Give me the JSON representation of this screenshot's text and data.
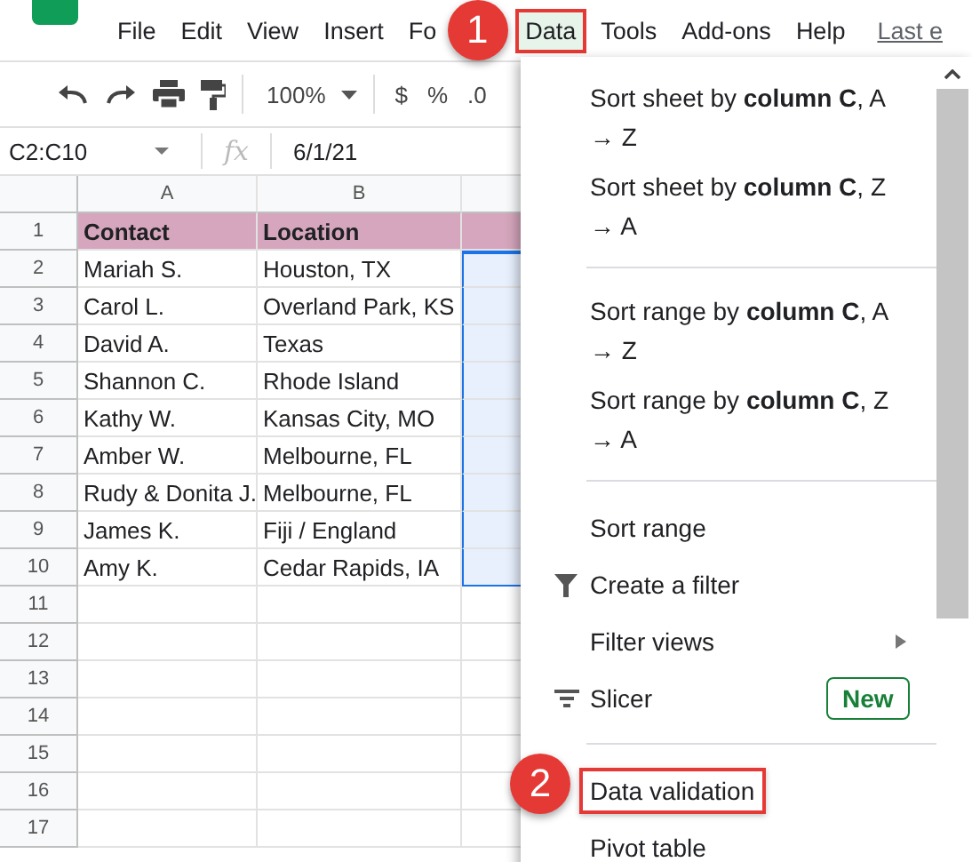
{
  "menu_bar": {
    "items": [
      {
        "label": "File",
        "selected": false
      },
      {
        "label": "Edit",
        "selected": false
      },
      {
        "label": "View",
        "selected": false
      },
      {
        "label": "Insert",
        "selected": false
      },
      {
        "label": "Fo",
        "selected": false
      },
      {
        "label": "Data",
        "selected": true
      },
      {
        "label": "Tools",
        "selected": false
      },
      {
        "label": "Add-ons",
        "selected": false
      },
      {
        "label": "Help",
        "selected": false
      }
    ],
    "last_edit": "Last e"
  },
  "toolbar": {
    "zoom": "100%",
    "currency": "$",
    "percent": "%",
    "decimal": ".0"
  },
  "formula_bar": {
    "name_box": "C2:C10",
    "fx": "fx",
    "value": "6/1/21"
  },
  "sheet": {
    "columns": [
      "A",
      "B"
    ],
    "rows": [
      {
        "number": "1",
        "kind": "header",
        "cells": [
          "Contact",
          "Location"
        ],
        "selected": false
      },
      {
        "number": "2",
        "kind": "data",
        "cells": [
          "Mariah S.",
          "Houston, TX"
        ],
        "selected": true
      },
      {
        "number": "3",
        "kind": "data",
        "cells": [
          "Carol L.",
          "Overland Park, KS"
        ],
        "selected": true
      },
      {
        "number": "4",
        "kind": "data",
        "cells": [
          "David A.",
          "Texas"
        ],
        "selected": true
      },
      {
        "number": "5",
        "kind": "data",
        "cells": [
          "Shannon C.",
          "Rhode Island"
        ],
        "selected": true
      },
      {
        "number": "6",
        "kind": "data",
        "cells": [
          "Kathy W.",
          "Kansas City, MO"
        ],
        "selected": true
      },
      {
        "number": "7",
        "kind": "data",
        "cells": [
          "Amber W.",
          "Melbourne, FL"
        ],
        "selected": true
      },
      {
        "number": "8",
        "kind": "data",
        "cells": [
          "Rudy & Donita J.",
          "Melbourne, FL"
        ],
        "selected": true
      },
      {
        "number": "9",
        "kind": "data",
        "cells": [
          "James K.",
          "Fiji / England"
        ],
        "selected": true
      },
      {
        "number": "10",
        "kind": "data",
        "cells": [
          "Amy K.",
          "Cedar Rapids, IA"
        ],
        "selected": true
      },
      {
        "number": "11",
        "kind": "data",
        "cells": [],
        "selected": false
      },
      {
        "number": "12",
        "kind": "data",
        "cells": [],
        "selected": false
      },
      {
        "number": "13",
        "kind": "data",
        "cells": [],
        "selected": false
      },
      {
        "number": "14",
        "kind": "data",
        "cells": [],
        "selected": false
      },
      {
        "number": "15",
        "kind": "data",
        "cells": [],
        "selected": false
      },
      {
        "number": "16",
        "kind": "data",
        "cells": [],
        "selected": false
      },
      {
        "number": "17",
        "kind": "data",
        "cells": [],
        "selected": false
      }
    ]
  },
  "data_menu": {
    "items": [
      {
        "kind": "item",
        "label": "Sort sheet by **column C**, A → Z",
        "highlighted": false
      },
      {
        "kind": "item",
        "label": "Sort sheet by **column C**, Z → A",
        "highlighted": false
      },
      {
        "kind": "divider"
      },
      {
        "kind": "item",
        "label": "Sort range by **column C**, A → Z",
        "highlighted": false
      },
      {
        "kind": "item",
        "label": "Sort range by **column C**, Z → A",
        "highlighted": false
      },
      {
        "kind": "divider"
      },
      {
        "kind": "item",
        "label": "Sort range",
        "highlighted": false
      },
      {
        "kind": "filter",
        "label": "Create a filter",
        "highlighted": false
      },
      {
        "kind": "submenu",
        "label": "Filter views",
        "highlighted": false
      },
      {
        "kind": "slicer",
        "label": "Slicer",
        "badge": "New",
        "highlighted": false
      },
      {
        "kind": "divider"
      },
      {
        "kind": "item",
        "label": "Data validation",
        "highlighted": true
      },
      {
        "kind": "item",
        "label": "Pivot table",
        "highlighted": false
      }
    ]
  },
  "callouts": [
    {
      "number": "1"
    },
    {
      "number": "2"
    }
  ]
}
